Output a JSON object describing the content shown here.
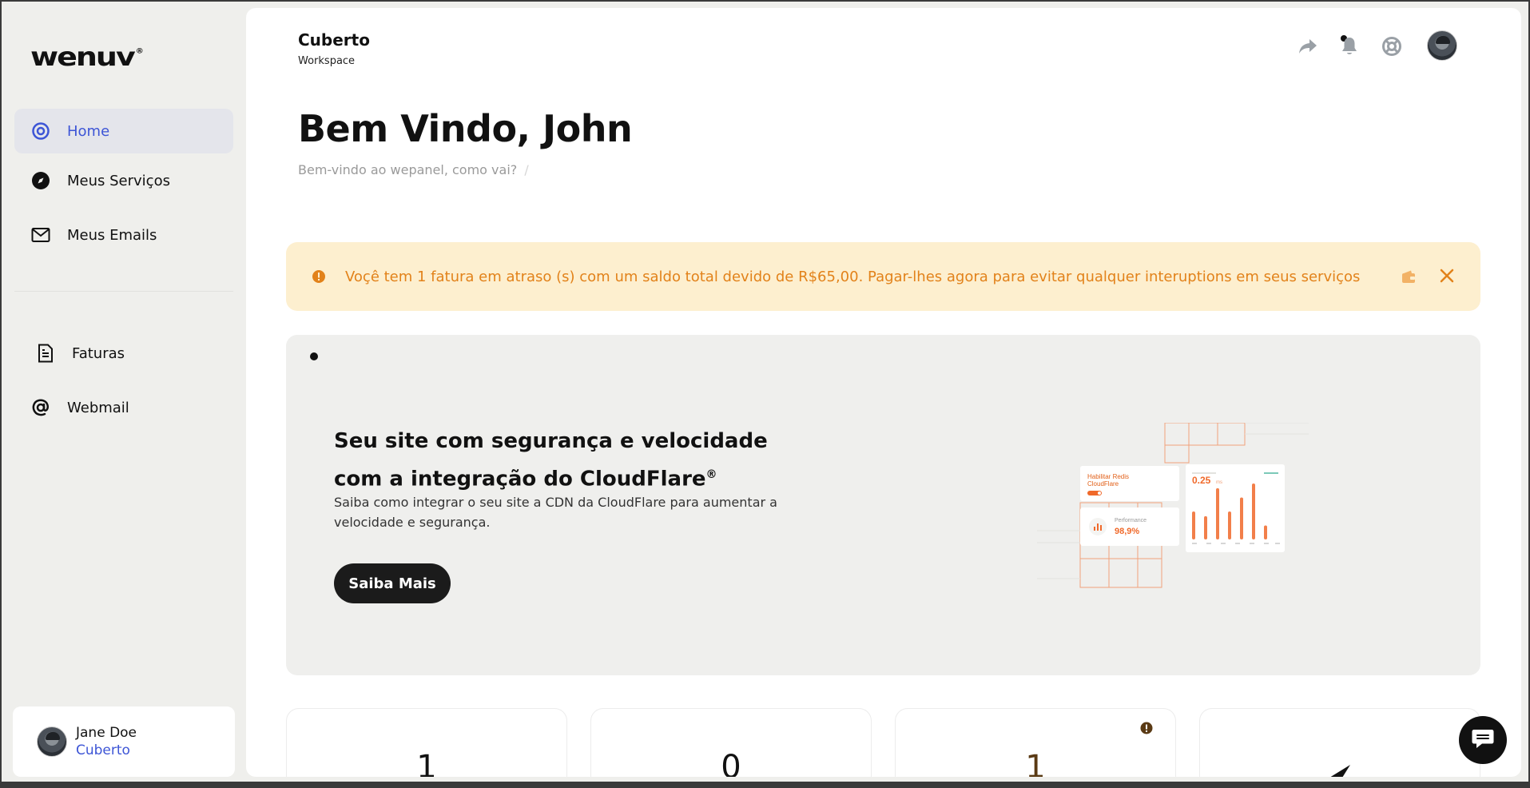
{
  "brand": {
    "logo": "wenuv",
    "logo_mark": "®"
  },
  "sidebar": {
    "items": [
      {
        "label": "Home",
        "icon": "target-icon",
        "active": true
      },
      {
        "label": "Meus Serviços",
        "icon": "compass-icon"
      },
      {
        "label": "Meus Emails",
        "icon": "mail-icon"
      },
      {
        "label": "Faturas",
        "icon": "invoice-icon"
      },
      {
        "label": "Webmail",
        "icon": "at-icon"
      }
    ]
  },
  "user": {
    "name": "Jane Doe",
    "org": "Cuberto"
  },
  "header": {
    "workspace_name": "Cuberto",
    "workspace_label": "Workspace",
    "icons": [
      "share-icon",
      "bell-icon",
      "help-lifebuoy-icon",
      "avatar"
    ]
  },
  "page": {
    "title": "Bem Vindo, John",
    "subtitle": "Bem-vindo ao wepanel, como vai?",
    "subtitle_sep": "/"
  },
  "alert": {
    "text": "Voçê tem 1 fatura em atraso (s) com um saldo total devido de R$65,00. Pagar-lhes agora para evitar qualquer interuptions em seus serviços",
    "color": "#e2821a"
  },
  "promo": {
    "title": "Seu site com segurança e velocidade com a integração do CloudFlare",
    "title_mark": "®",
    "description": "Saiba como integrar o seu site a CDN da CloudFlare para aumentar a velocidade e segurança.",
    "button": "Saiba Mais",
    "art": {
      "card1_title": "Habilitar Redis CloudFlare",
      "card2_label": "Performance",
      "card2_value": "98,9%",
      "card3_value": "0.25",
      "card3_unit": "ms",
      "bars": [
        0.3,
        0.25,
        0.55,
        0.3,
        0.45,
        0.6,
        0.15
      ]
    }
  },
  "stats": [
    {
      "value": "1"
    },
    {
      "value": "0"
    },
    {
      "value": "1",
      "warn": true
    },
    {
      "value": ""
    }
  ],
  "colors": {
    "accent": "#3d55d6",
    "warning": "#e2821a",
    "warning_bg": "#fdefcf"
  }
}
